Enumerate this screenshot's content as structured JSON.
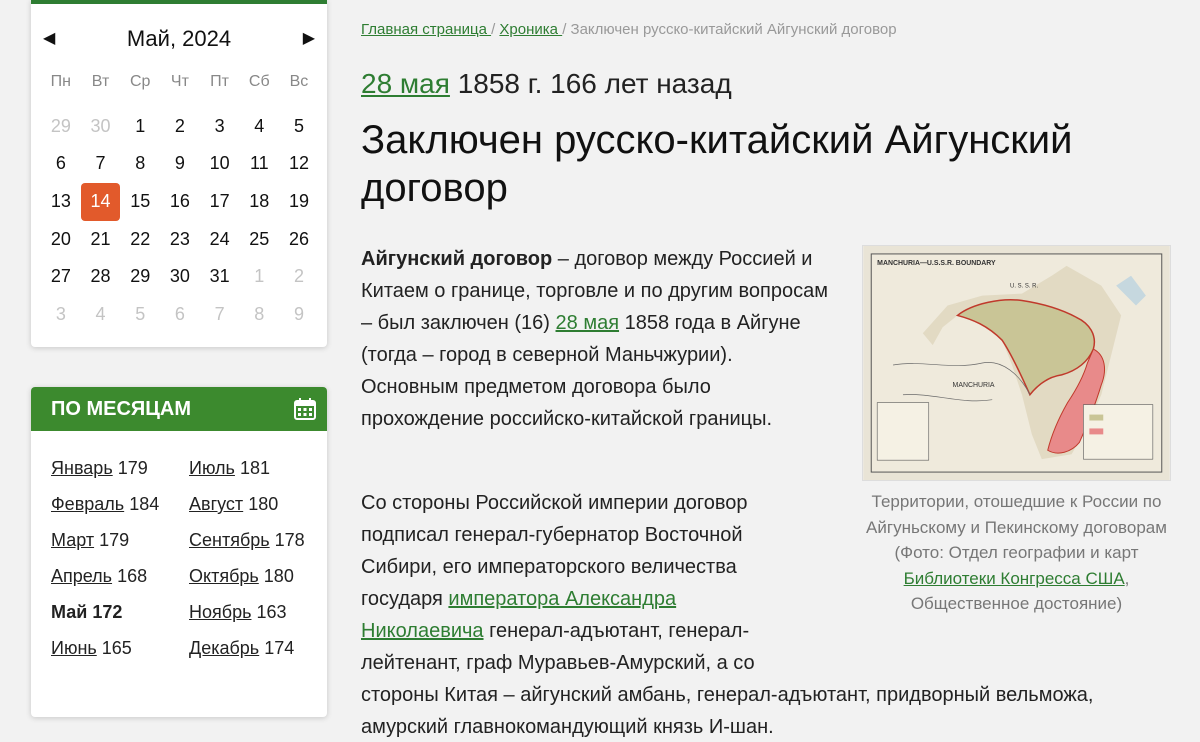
{
  "calendar": {
    "title": "Май, 2024",
    "prev": "◀",
    "next": "▶",
    "weekdays": [
      "Пн",
      "Вт",
      "Ср",
      "Чт",
      "Пт",
      "Сб",
      "Вс"
    ],
    "days": [
      {
        "n": "29",
        "m": true
      },
      {
        "n": "30",
        "m": true
      },
      {
        "n": "1"
      },
      {
        "n": "2"
      },
      {
        "n": "3"
      },
      {
        "n": "4"
      },
      {
        "n": "5"
      },
      {
        "n": "6"
      },
      {
        "n": "7"
      },
      {
        "n": "8"
      },
      {
        "n": "9"
      },
      {
        "n": "10"
      },
      {
        "n": "11"
      },
      {
        "n": "12"
      },
      {
        "n": "13"
      },
      {
        "n": "14",
        "t": true
      },
      {
        "n": "15"
      },
      {
        "n": "16"
      },
      {
        "n": "17"
      },
      {
        "n": "18"
      },
      {
        "n": "19"
      },
      {
        "n": "20"
      },
      {
        "n": "21"
      },
      {
        "n": "22"
      },
      {
        "n": "23"
      },
      {
        "n": "24"
      },
      {
        "n": "25"
      },
      {
        "n": "26"
      },
      {
        "n": "27"
      },
      {
        "n": "28"
      },
      {
        "n": "29"
      },
      {
        "n": "30"
      },
      {
        "n": "31"
      },
      {
        "n": "1",
        "m": true
      },
      {
        "n": "2",
        "m": true
      },
      {
        "n": "3",
        "m": true
      },
      {
        "n": "4",
        "m": true
      },
      {
        "n": "5",
        "m": true
      },
      {
        "n": "6",
        "m": true
      },
      {
        "n": "7",
        "m": true
      },
      {
        "n": "8",
        "m": true
      },
      {
        "n": "9",
        "m": true
      }
    ]
  },
  "months": {
    "title": "ПО МЕСЯЦАМ",
    "icon": "calendar-icon",
    "col1": [
      {
        "name": "Январь",
        "count": "179"
      },
      {
        "name": "Февраль",
        "count": "184"
      },
      {
        "name": "Март",
        "count": "179"
      },
      {
        "name": "Апрель",
        "count": "168"
      },
      {
        "name": "Май",
        "count": "172",
        "current": true
      },
      {
        "name": "Июнь",
        "count": "165"
      }
    ],
    "col2": [
      {
        "name": "Июль",
        "count": "181"
      },
      {
        "name": "Август",
        "count": "180"
      },
      {
        "name": "Сентябрь",
        "count": "178"
      },
      {
        "name": "Октябрь",
        "count": "180"
      },
      {
        "name": "Ноябрь",
        "count": "163"
      },
      {
        "name": "Декабрь",
        "count": "174"
      }
    ]
  },
  "breadcrumb": {
    "home": "Главная страница ",
    "sep1": " / ",
    "chronicle": "Хроника ",
    "sep2": " / ",
    "current": "Заключен русско-китайский Айгунский договор"
  },
  "event": {
    "date_link": "28 мая",
    "year": " 1858 г. 166 лет назад",
    "title": "Заключен русско-китайский Айгунский договор"
  },
  "article": {
    "p1_bold": "Айгунский договор",
    "p1_a": " – договор между Россией и Китаем о границе, торговле и по другим вопросам – был заключен (16) ",
    "p1_link": "28 мая",
    "p1_b": " 1858 года в Айгуне (тогда – город в северной Маньчжурии). Основным предметом договора было прохождение российско-китайской границы.",
    "p2_l1": "Со стороны Российской империи договор",
    "p2_l2": "подписал генерал-губернатор Восточной",
    "p2_l3": "Сибири, его императорского величества",
    "p2_l4a": "государя ",
    "p2_link_a": "императора Александра",
    "p2_link_b": "Николаевича",
    "p2_l5": " генерал-адъютант, генерал-",
    "p2_l6": "лейтенант, граф Муравьев-Амурский, а со",
    "p2_l7": "стороны Китая – айгунский амбань, генерал-адъютант, придворный вельможа,",
    "p2_l8": "амурский главнокомандующий князь И-шан."
  },
  "figure": {
    "map_title": "MANCHURIA—U.S.S.R. BOUNDARY",
    "map_label_ussr": "U. S. S. R.",
    "map_label_manchuria": "MANCHURIA",
    "caption_a": "Территории, отошедшие к России по Айгуньскому и Пекинскому договорам (Фото: Отдел географии и карт ",
    "caption_link": "Библиотеки Конгресса США",
    "caption_b": ", Общественное достояние)"
  }
}
